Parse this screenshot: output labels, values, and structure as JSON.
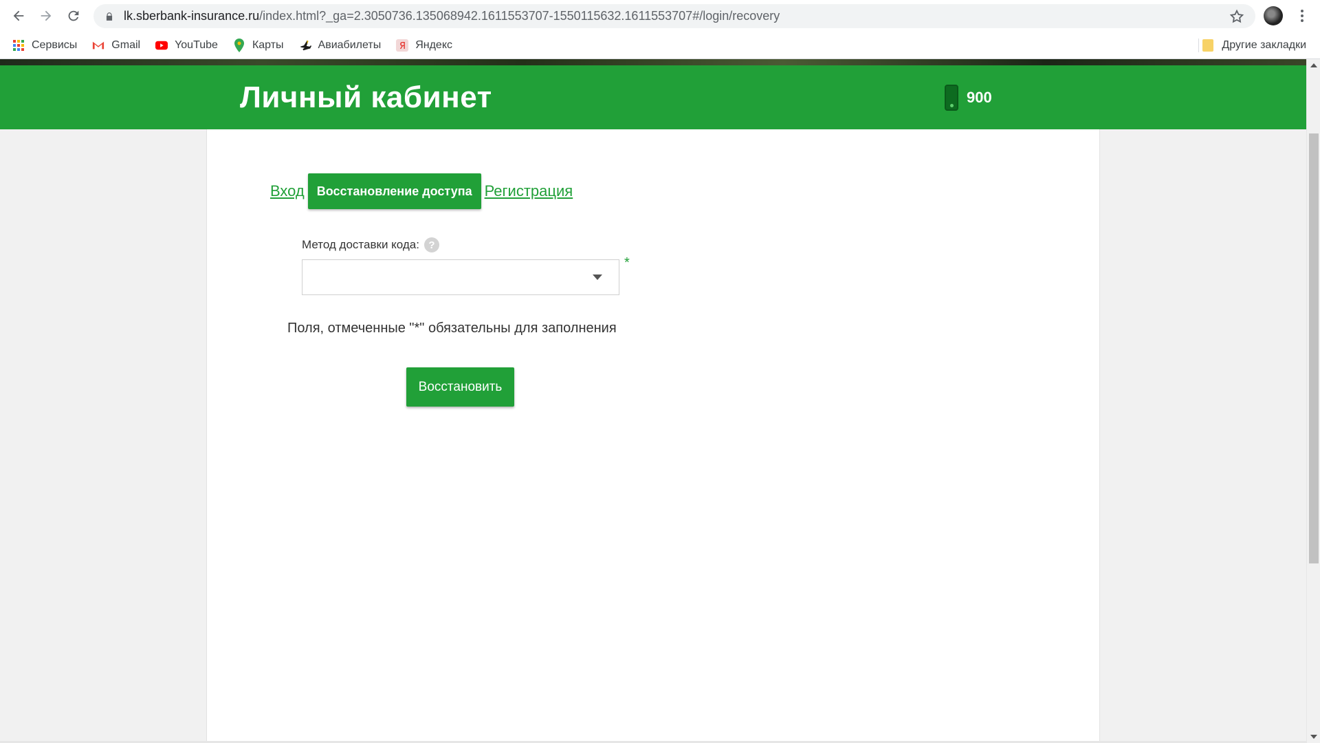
{
  "browser": {
    "url_host": "lk.sberbank-insurance.ru",
    "url_path": "/index.html?_ga=2.3050736.135068942.1611553707-1550115632.1611553707#/login/recovery",
    "bookmarks": [
      {
        "label": "Сервисы",
        "icon": "apps-grid-icon"
      },
      {
        "label": "Gmail",
        "icon": "gmail-icon"
      },
      {
        "label": "YouTube",
        "icon": "youtube-icon"
      },
      {
        "label": "Карты",
        "icon": "maps-pin-icon"
      },
      {
        "label": "Авиабилеты",
        "icon": "airplane-icon"
      },
      {
        "label": "Яндекс",
        "icon": "yandex-icon"
      }
    ],
    "other_bookmarks": "Другие закладки"
  },
  "header": {
    "title": "Личный кабинет",
    "phone": "900",
    "brand_color": "#21a038"
  },
  "tabs": {
    "login": "Вход",
    "recovery": "Восстановление доступа",
    "register": "Регистрация"
  },
  "form": {
    "delivery_label": "Метод доставки кода:",
    "help_glyph": "?",
    "delivery_value": "",
    "required_mark": "*",
    "note": "Поля, отмеченные \"*\" обязательны для заполнения",
    "submit_label": "Восстановить"
  }
}
